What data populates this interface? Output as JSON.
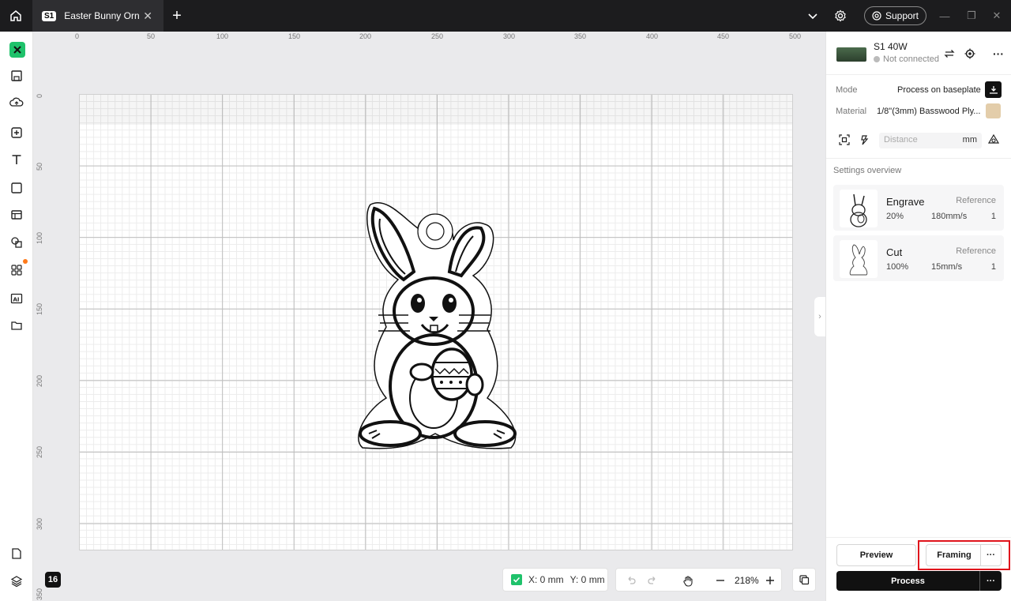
{
  "tab": {
    "badge": "S1",
    "title": "Easter Bunny Ornament",
    "title_display": "Easter Bunny Orn..."
  },
  "header": {
    "support_label": "Support"
  },
  "ruler": {
    "x_ticks": [
      "0",
      "50",
      "100",
      "150",
      "200",
      "250",
      "300",
      "350",
      "400",
      "450",
      "500"
    ],
    "y_ticks": [
      "0",
      "50",
      "100",
      "150",
      "200",
      "250",
      "300",
      "350"
    ]
  },
  "layers_count": "16",
  "coords": {
    "x": "X: 0 mm",
    "y": "Y: 0 mm"
  },
  "zoom": {
    "level": "218%"
  },
  "device": {
    "name": "S1 40W",
    "status": "Not connected"
  },
  "settings": {
    "mode_label": "Mode",
    "mode_value": "Process on baseplate",
    "material_label": "Material",
    "material_value": "1/8\"(3mm) Basswood Ply...",
    "material_color": "#e3cdaa",
    "distance_placeholder": "Distance",
    "distance_unit": "mm"
  },
  "overview": {
    "title": "Settings overview",
    "items": [
      {
        "name": "Engrave",
        "ref": "Reference",
        "power": "20%",
        "speed": "180mm/s",
        "passes": "1"
      },
      {
        "name": "Cut",
        "ref": "Reference",
        "power": "100%",
        "speed": "15mm/s",
        "passes": "1"
      }
    ]
  },
  "actions": {
    "preview": "Preview",
    "framing": "Framing",
    "process": "Process",
    "more": "···"
  },
  "colors": {
    "accent": "#1fc26b",
    "highlight": "#e0141c",
    "topbar": "#1c1c1e"
  }
}
